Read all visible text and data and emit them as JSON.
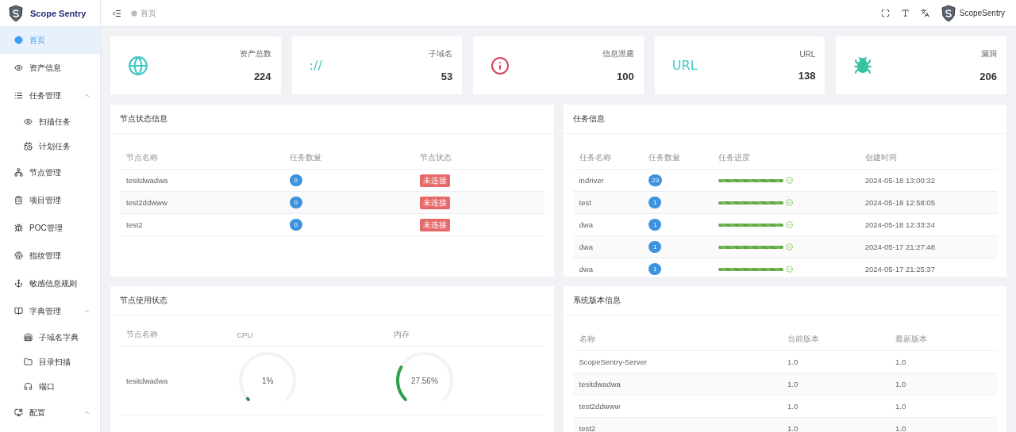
{
  "brand": {
    "name": "Scope Sentry"
  },
  "sidebar": {
    "items": [
      {
        "label": "首页",
        "selected": true
      },
      {
        "label": "资产信息",
        "selected": false
      },
      {
        "label": "任务管理",
        "selected": false,
        "expanded": true,
        "children": [
          {
            "label": "扫描任务",
            "selected": false
          },
          {
            "label": "计划任务",
            "selected": false
          }
        ]
      },
      {
        "label": "节点管理",
        "selected": false
      },
      {
        "label": "项目管理",
        "selected": false
      },
      {
        "label": "POC管理",
        "selected": false
      },
      {
        "label": "指纹管理",
        "selected": false
      },
      {
        "label": "敏感信息规则",
        "selected": false
      },
      {
        "label": "字典管理",
        "selected": false,
        "expanded": true,
        "children": [
          {
            "label": "子域名字典",
            "selected": false
          },
          {
            "label": "目录扫描",
            "selected": false
          },
          {
            "label": "端口",
            "selected": false
          }
        ]
      },
      {
        "label": "配置",
        "selected": false,
        "expanded": true
      }
    ]
  },
  "header": {
    "breadcrumb": "首页",
    "user": "ScopeSentry"
  },
  "stats": [
    {
      "kind": "globe",
      "color": "#40c9c6",
      "label": "资产总数",
      "value": "224"
    },
    {
      "kind": "glyph",
      "glyph": "://",
      "color": "#40c9c6",
      "label": "子域名",
      "value": "53"
    },
    {
      "kind": "info",
      "color": "#d6455d",
      "label": "信息泄露",
      "value": "100"
    },
    {
      "kind": "glyph",
      "glyph": "URL",
      "color": "#40c9c6",
      "label": "URL",
      "value": "138"
    },
    {
      "kind": "bug",
      "color": "#36c3a0",
      "label": "漏洞",
      "value": "206"
    }
  ],
  "node_status": {
    "title": "节点状态信息",
    "columns": [
      "节点名称",
      "任务数量",
      "节点状态"
    ],
    "rows": [
      {
        "name": "tesitdwadwa",
        "tasks": "0",
        "status": "未连接",
        "kind": "danger"
      },
      {
        "name": "test2ddwww",
        "tasks": "0",
        "status": "未连接",
        "kind": "danger"
      },
      {
        "name": "test2",
        "tasks": "0",
        "status": "未连接",
        "kind": "danger"
      }
    ]
  },
  "task_info": {
    "title": "任务信息",
    "columns": [
      "任务名称",
      "任务数量",
      "任务进度",
      "创建时间"
    ],
    "rows": [
      {
        "name": "indriver",
        "count": "23",
        "level": 1,
        "done": true,
        "created": "2024-05-18 13:00:32"
      },
      {
        "name": "test",
        "count": "1",
        "level": 1,
        "done": true,
        "created": "2024-05-18 12:58:05"
      },
      {
        "name": "dwa",
        "count": "1",
        "level": 1,
        "done": true,
        "created": "2024-05-18 12:33:34"
      },
      {
        "name": "dwa",
        "count": "1",
        "level": 1,
        "done": true,
        "created": "2024-05-17 21:27:48"
      },
      {
        "name": "dwa",
        "count": "1",
        "level": 1,
        "done": true,
        "created": "2024-05-17 21:25:37"
      }
    ]
  },
  "node_usage": {
    "title": "节点使用状态",
    "columns": [
      "节点名称",
      "CPU",
      "内存"
    ],
    "rows": [
      {
        "name": "tesitdwadwa",
        "cpu": {
          "reading": "1%",
          "color": "#2f8f5b"
        },
        "memory": {
          "reading": "27.56%",
          "color": "#2ea04a"
        }
      }
    ]
  },
  "versions": {
    "title": "系统版本信息",
    "columns": [
      "名称",
      "当前版本",
      "最新版本"
    ],
    "rows": [
      {
        "name": "ScopeSentry-Server",
        "current": "1.0",
        "latest": "1.0"
      },
      {
        "name": "tesitdwadwa",
        "current": "1.0",
        "latest": "1.0"
      },
      {
        "name": "test2ddwww",
        "current": "1.0",
        "latest": "1.0"
      },
      {
        "name": "test2",
        "current": "1.0",
        "latest": "1.0"
      }
    ]
  }
}
